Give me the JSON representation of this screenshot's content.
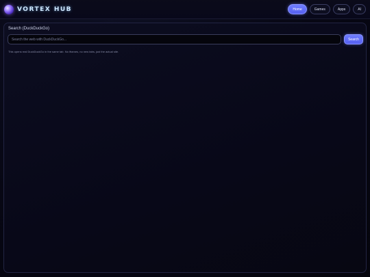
{
  "header": {
    "brand": "VORTEX HUB",
    "logo_icon": "orb-logo-icon",
    "nav": [
      {
        "label": "Home",
        "active": true
      },
      {
        "label": "Games",
        "active": false
      },
      {
        "label": "Apps",
        "active": false
      },
      {
        "label": "AI",
        "active": false
      }
    ]
  },
  "search": {
    "title": "Search (DuckDuckGo)",
    "placeholder": "Search the web with DuckDuckGo...",
    "value": "",
    "button_label": "Search",
    "hint": "This opens real DuckDuckGo in the same tab. No iframes, no new tabs, just the actual site."
  },
  "colors": {
    "accent": "#6f7dff",
    "background": "#06060f",
    "panel_border": "#222443"
  }
}
